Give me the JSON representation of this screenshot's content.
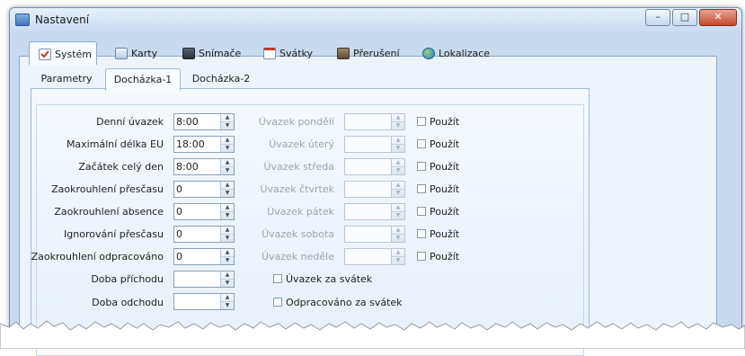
{
  "window": {
    "title": "Nastavení",
    "controls": {
      "minimize": "–",
      "maximize": "□",
      "close": "✕"
    }
  },
  "main_tabs": [
    {
      "label": "Systém",
      "icon": "checklist-icon",
      "active": true
    },
    {
      "label": "Karty",
      "icon": "cards-icon",
      "active": false
    },
    {
      "label": "Snímače",
      "icon": "reader-icon",
      "active": false
    },
    {
      "label": "Svátky",
      "icon": "calendar-icon",
      "active": false
    },
    {
      "label": "Přerušení",
      "icon": "pause-icon",
      "active": false
    },
    {
      "label": "Lokalizace",
      "icon": "globe-icon",
      "active": false
    }
  ],
  "sub_tabs": [
    {
      "label": "Parametry",
      "active": false
    },
    {
      "label": "Docházka-1",
      "active": true
    },
    {
      "label": "Docházka-2",
      "active": false
    }
  ],
  "left_fields": [
    {
      "label": "Denní úvazek",
      "value": "8:00"
    },
    {
      "label": "Maximální délka EU",
      "value": "18:00"
    },
    {
      "label": "Začátek celý den",
      "value": "8:00"
    },
    {
      "label": "Zaokrouhlení přesčasu",
      "value": "0"
    },
    {
      "label": "Zaokrouhlení absence",
      "value": "0"
    },
    {
      "label": "Ignorování přesčasu",
      "value": "0"
    },
    {
      "label": "Zaokrouhlení odpracováno",
      "value": "0"
    },
    {
      "label": "Doba příchodu",
      "value": ""
    },
    {
      "label": "Doba odchodu",
      "value": ""
    }
  ],
  "day_fields": [
    {
      "label": "Úvazek pondělí",
      "value": "",
      "check_label": "Použít",
      "checked": false
    },
    {
      "label": "Úvazek úterý",
      "value": "",
      "check_label": "Použít",
      "checked": false
    },
    {
      "label": "Úvazek středa",
      "value": "",
      "check_label": "Použít",
      "checked": false
    },
    {
      "label": "Úvazek čtvrtek",
      "value": "",
      "check_label": "Použít",
      "checked": false
    },
    {
      "label": "Úvazek pátek",
      "value": "",
      "check_label": "Použít",
      "checked": false
    },
    {
      "label": "Úvazek sobota",
      "value": "",
      "check_label": "Použít",
      "checked": false
    },
    {
      "label": "Úvazek neděle",
      "value": "",
      "check_label": "Použít",
      "checked": false
    }
  ],
  "holiday_options": [
    {
      "label": "Úvazek za svátek",
      "checked": false
    },
    {
      "label": "Odpracováno za svátek",
      "checked": false
    }
  ],
  "colors": {
    "accent": "#3d76b8",
    "frame": "#c7daf0",
    "disabled_text": "#9aa4b2"
  }
}
